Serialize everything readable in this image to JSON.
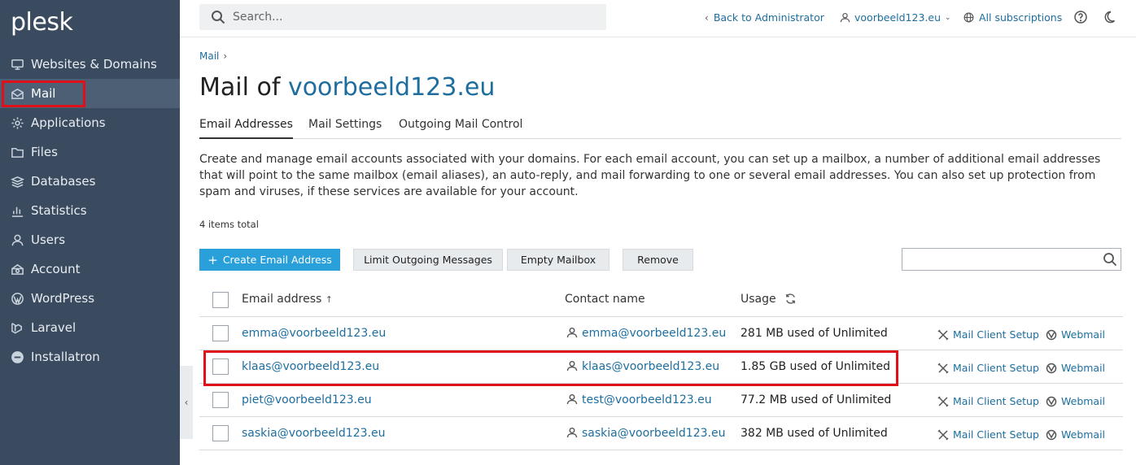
{
  "brand": "plesk",
  "sidebar": {
    "items": [
      {
        "label": "Websites & Domains",
        "icon": "monitor-icon"
      },
      {
        "label": "Mail",
        "icon": "mail-icon"
      },
      {
        "label": "Applications",
        "icon": "gear-icon"
      },
      {
        "label": "Files",
        "icon": "folder-icon"
      },
      {
        "label": "Databases",
        "icon": "database-icon"
      },
      {
        "label": "Statistics",
        "icon": "bar-chart-icon"
      },
      {
        "label": "Users",
        "icon": "user-icon"
      },
      {
        "label": "Account",
        "icon": "account-icon"
      },
      {
        "label": "WordPress",
        "icon": "wordpress-icon"
      },
      {
        "label": "Laravel",
        "icon": "laravel-icon"
      },
      {
        "label": "Installatron",
        "icon": "installatron-icon"
      }
    ],
    "active": "Mail",
    "collapse_glyph": "‹"
  },
  "topbar": {
    "search_placeholder": "Search...",
    "back_label": "Back to Administrator",
    "user_label": "voorbeeld123.eu",
    "subscriptions_label": "All subscriptions"
  },
  "breadcrumb": {
    "item": "Mail",
    "separator": "›"
  },
  "page": {
    "title_prefix": "Mail of",
    "title_domain": "voorbeeld123.eu"
  },
  "tabs": [
    {
      "label": "Email Addresses",
      "active": true
    },
    {
      "label": "Mail Settings",
      "active": false
    },
    {
      "label": "Outgoing Mail Control",
      "active": false
    }
  ],
  "description": "Create and manage email accounts associated with your domains. For each email account, you can set up a mailbox, a number of additional email addresses that will point to the same mailbox (email aliases), an auto-reply, and mail forwarding to one or several email addresses. You can also set up protection from spam and viruses, if these services are available for your account.",
  "items_total": "4 items total",
  "toolbar": {
    "create_label": "Create Email Address",
    "limit_label": "Limit Outgoing Messages",
    "empty_label": "Empty Mailbox",
    "remove_label": "Remove"
  },
  "table": {
    "headers": {
      "email": "Email address",
      "sort_glyph": "↑",
      "contact": "Contact name",
      "usage": "Usage"
    },
    "rows": [
      {
        "email": "emma@voorbeeld123.eu",
        "contact": "emma@voorbeeld123.eu",
        "usage": "281 MB used of Unlimited",
        "setup": "Mail Client Setup",
        "webmail": "Webmail"
      },
      {
        "email": "klaas@voorbeeld123.eu",
        "contact": "klaas@voorbeeld123.eu",
        "usage": "1.85 GB used of Unlimited",
        "setup": "Mail Client Setup",
        "webmail": "Webmail"
      },
      {
        "email": "piet@voorbeeld123.eu",
        "contact": "test@voorbeeld123.eu",
        "usage": "77.2 MB used of Unlimited",
        "setup": "Mail Client Setup",
        "webmail": "Webmail"
      },
      {
        "email": "saskia@voorbeeld123.eu",
        "contact": "saskia@voorbeeld123.eu",
        "usage": "382 MB used of Unlimited",
        "setup": "Mail Client Setup",
        "webmail": "Webmail"
      }
    ]
  },
  "colors": {
    "sidebar_bg": "#3b4b5f",
    "link": "#1d6e9e",
    "primary_button": "#29a0da",
    "highlight": "#e0101a"
  }
}
